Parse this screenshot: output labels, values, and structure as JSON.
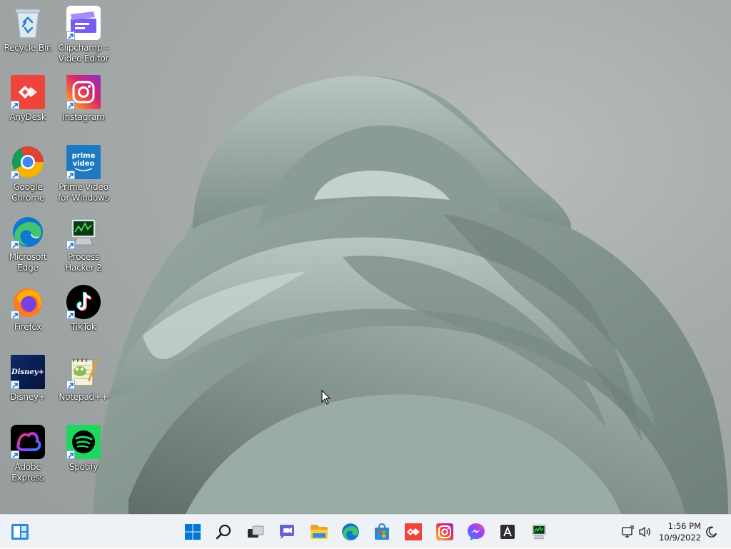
{
  "desktop": {
    "icons": [
      {
        "label": "Recycle Bin",
        "icon": "recycle-bin-icon"
      },
      {
        "label": "Clipchamp –\nVideo Editor",
        "icon": "clipchamp-icon"
      },
      {
        "label": "AnyDesk",
        "icon": "anydesk-icon"
      },
      {
        "label": "Instagram",
        "icon": "instagram-icon"
      },
      {
        "label": "Google\nChrome",
        "icon": "chrome-icon"
      },
      {
        "label": "Prime Video\nfor Windows",
        "icon": "prime-video-icon"
      },
      {
        "label": "Microsoft\nEdge",
        "icon": "edge-icon"
      },
      {
        "label": "Process\nHacker 2",
        "icon": "process-hacker-icon"
      },
      {
        "label": "Firefox",
        "icon": "firefox-icon"
      },
      {
        "label": "TikTok",
        "icon": "tiktok-icon"
      },
      {
        "label": "Disney+",
        "icon": "disney-plus-icon"
      },
      {
        "label": "Notepad++",
        "icon": "notepad-plus-plus-icon"
      },
      {
        "label": "Adobe\nExpress",
        "icon": "adobe-express-icon"
      },
      {
        "label": "Spotify",
        "icon": "spotify-icon"
      }
    ],
    "tile_texts": {
      "prime": "prime\nvideo",
      "disney": "Disney+"
    }
  },
  "taskbar": {
    "clock_time": "1:56 PM",
    "clock_date": "10/9/2022",
    "colors": {
      "start_blue": "#0078d4",
      "background": "#eef1f5"
    }
  }
}
